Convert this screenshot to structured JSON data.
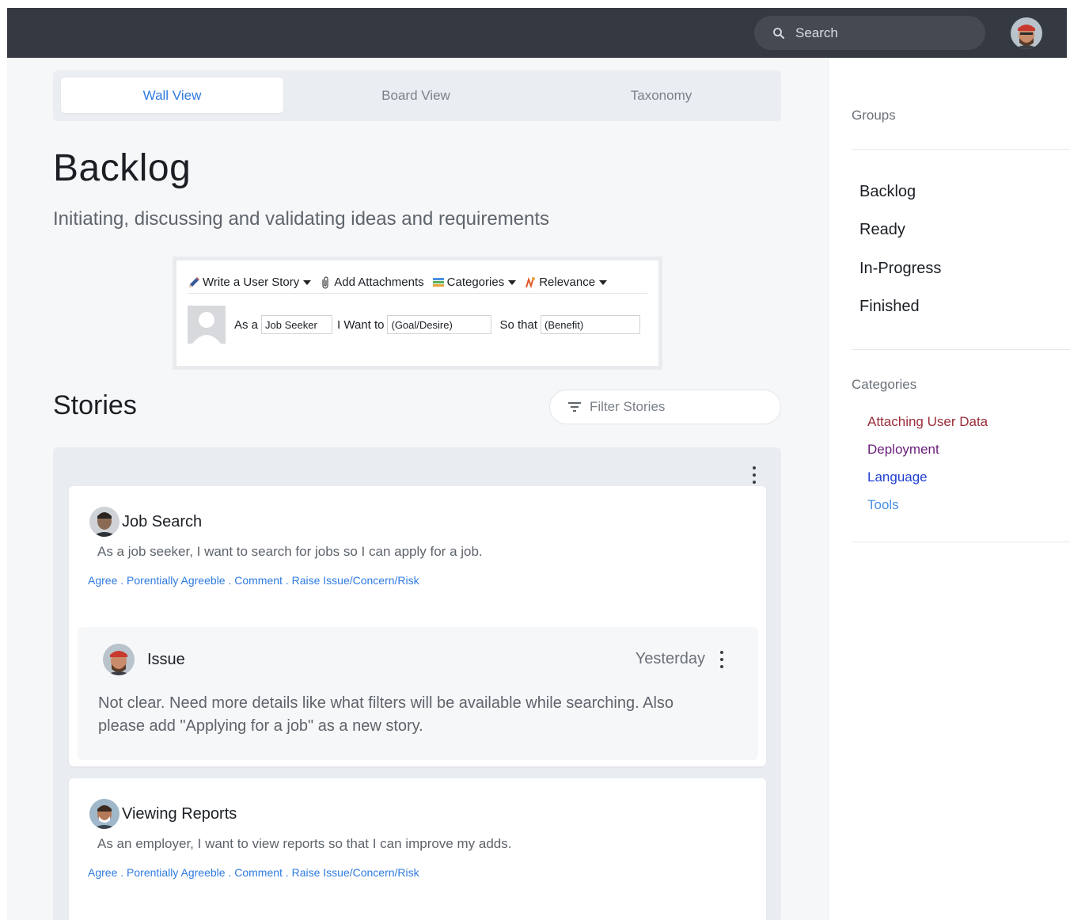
{
  "header": {
    "search": {
      "placeholder": "Search",
      "icon": "search-icon"
    },
    "user_avatar": "user-avatar"
  },
  "tabs": [
    {
      "label": "Wall View",
      "active": true
    },
    {
      "label": "Board View",
      "active": false
    },
    {
      "label": "Taxonomy",
      "active": false
    }
  ],
  "page": {
    "title": "Backlog",
    "subtitle": "Initiating, discussing and validating ideas and requirements"
  },
  "composer": {
    "toolbar": {
      "write": "Write a User Story",
      "attach": "Add Attachments",
      "categories": "Categories",
      "relevance": "Relevance"
    },
    "row": {
      "as_a": "As a",
      "role_value": "Job Seeker",
      "i_want_to": "I Want to",
      "goal_placeholder": "(Goal/Desire)",
      "so_that": "So that",
      "benefit_placeholder": "(Benefit)"
    }
  },
  "stories": {
    "title": "Stories",
    "filter_placeholder": "Filter Stories",
    "actions": {
      "agree": "Agree",
      "sep": " . ",
      "potentially": "Porentially Agreeble",
      "comment": "Comment",
      "raise": "Raise Issue/Concern/Risk"
    },
    "items": [
      {
        "title": "Job Search",
        "description": "As a job seeker, I want to search for jobs so I can apply for a job.",
        "comment": {
          "type": "Issue",
          "time": "Yesterday",
          "text": "Not clear. Need more details like what filters will be available while searching. Also please add \"Applying for a job\" as a new story."
        }
      },
      {
        "title": "Viewing Reports",
        "description": "As an employer, I want to view reports so that I can improve my adds."
      }
    ]
  },
  "sidebar": {
    "groups_label": "Groups",
    "groups": [
      "Backlog",
      "Ready",
      "In-Progress",
      "Finished"
    ],
    "categories_label": "Categories",
    "categories": [
      {
        "label": "Attaching User Data",
        "color": "#9b2d3a"
      },
      {
        "label": "Deployment",
        "color": "#6a1f7a"
      },
      {
        "label": "Language",
        "color": "#1f3fd1"
      },
      {
        "label": "Tools",
        "color": "#4a8fe7"
      }
    ]
  }
}
